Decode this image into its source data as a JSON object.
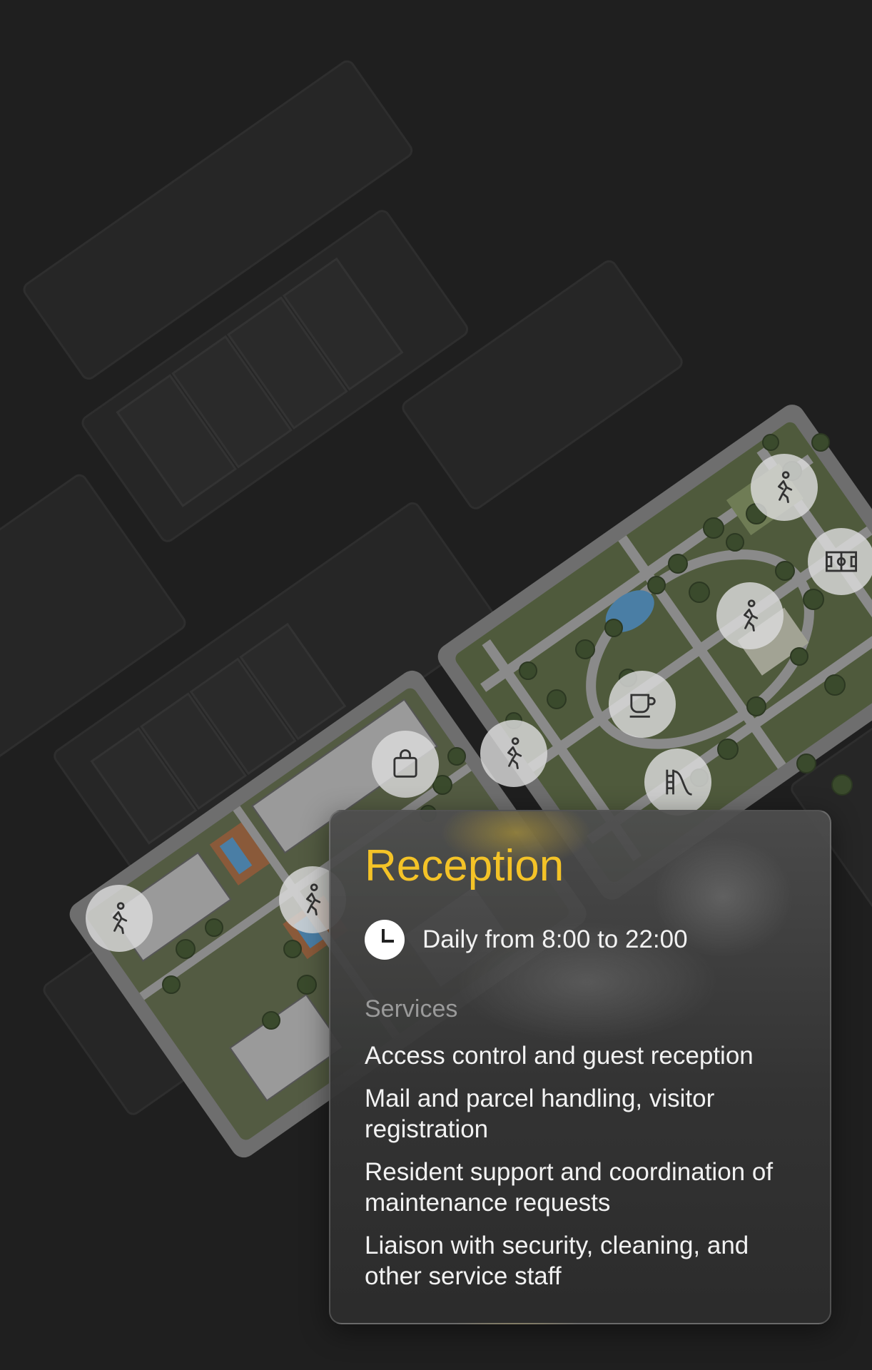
{
  "map": {
    "colors": {
      "background": "#1f1f1f",
      "block": "#2b2b2b",
      "estate": "#6e6e6e",
      "path": "#8a8a8a",
      "green": "#4f5a3c",
      "tree": "#3a4a2c",
      "pond": "#4a7ea5",
      "building": "#9a9a9a",
      "pin": "#dcdcdc"
    },
    "pins": [
      {
        "icon": "walking-person-icon"
      },
      {
        "icon": "sports-field-icon"
      },
      {
        "icon": "walking-person-icon"
      },
      {
        "icon": "coffee-cup-icon"
      },
      {
        "icon": "walking-person-icon"
      },
      {
        "icon": "shopping-bag-icon"
      },
      {
        "icon": "playground-slide-icon"
      },
      {
        "icon": "walking-person-icon"
      },
      {
        "icon": "walking-person-icon"
      }
    ]
  },
  "card": {
    "title": "Reception",
    "title_color": "#f4c327",
    "hours": "Daily from 8:00 to 22:00",
    "hours_icon": "clock-icon",
    "services_heading": "Services",
    "services": [
      "Access control and guest reception",
      "Mail and parcel handling, visitor registration",
      "Resident support and coordination of maintenance requests",
      "Liaison with security, cleaning, and other service staff"
    ]
  }
}
